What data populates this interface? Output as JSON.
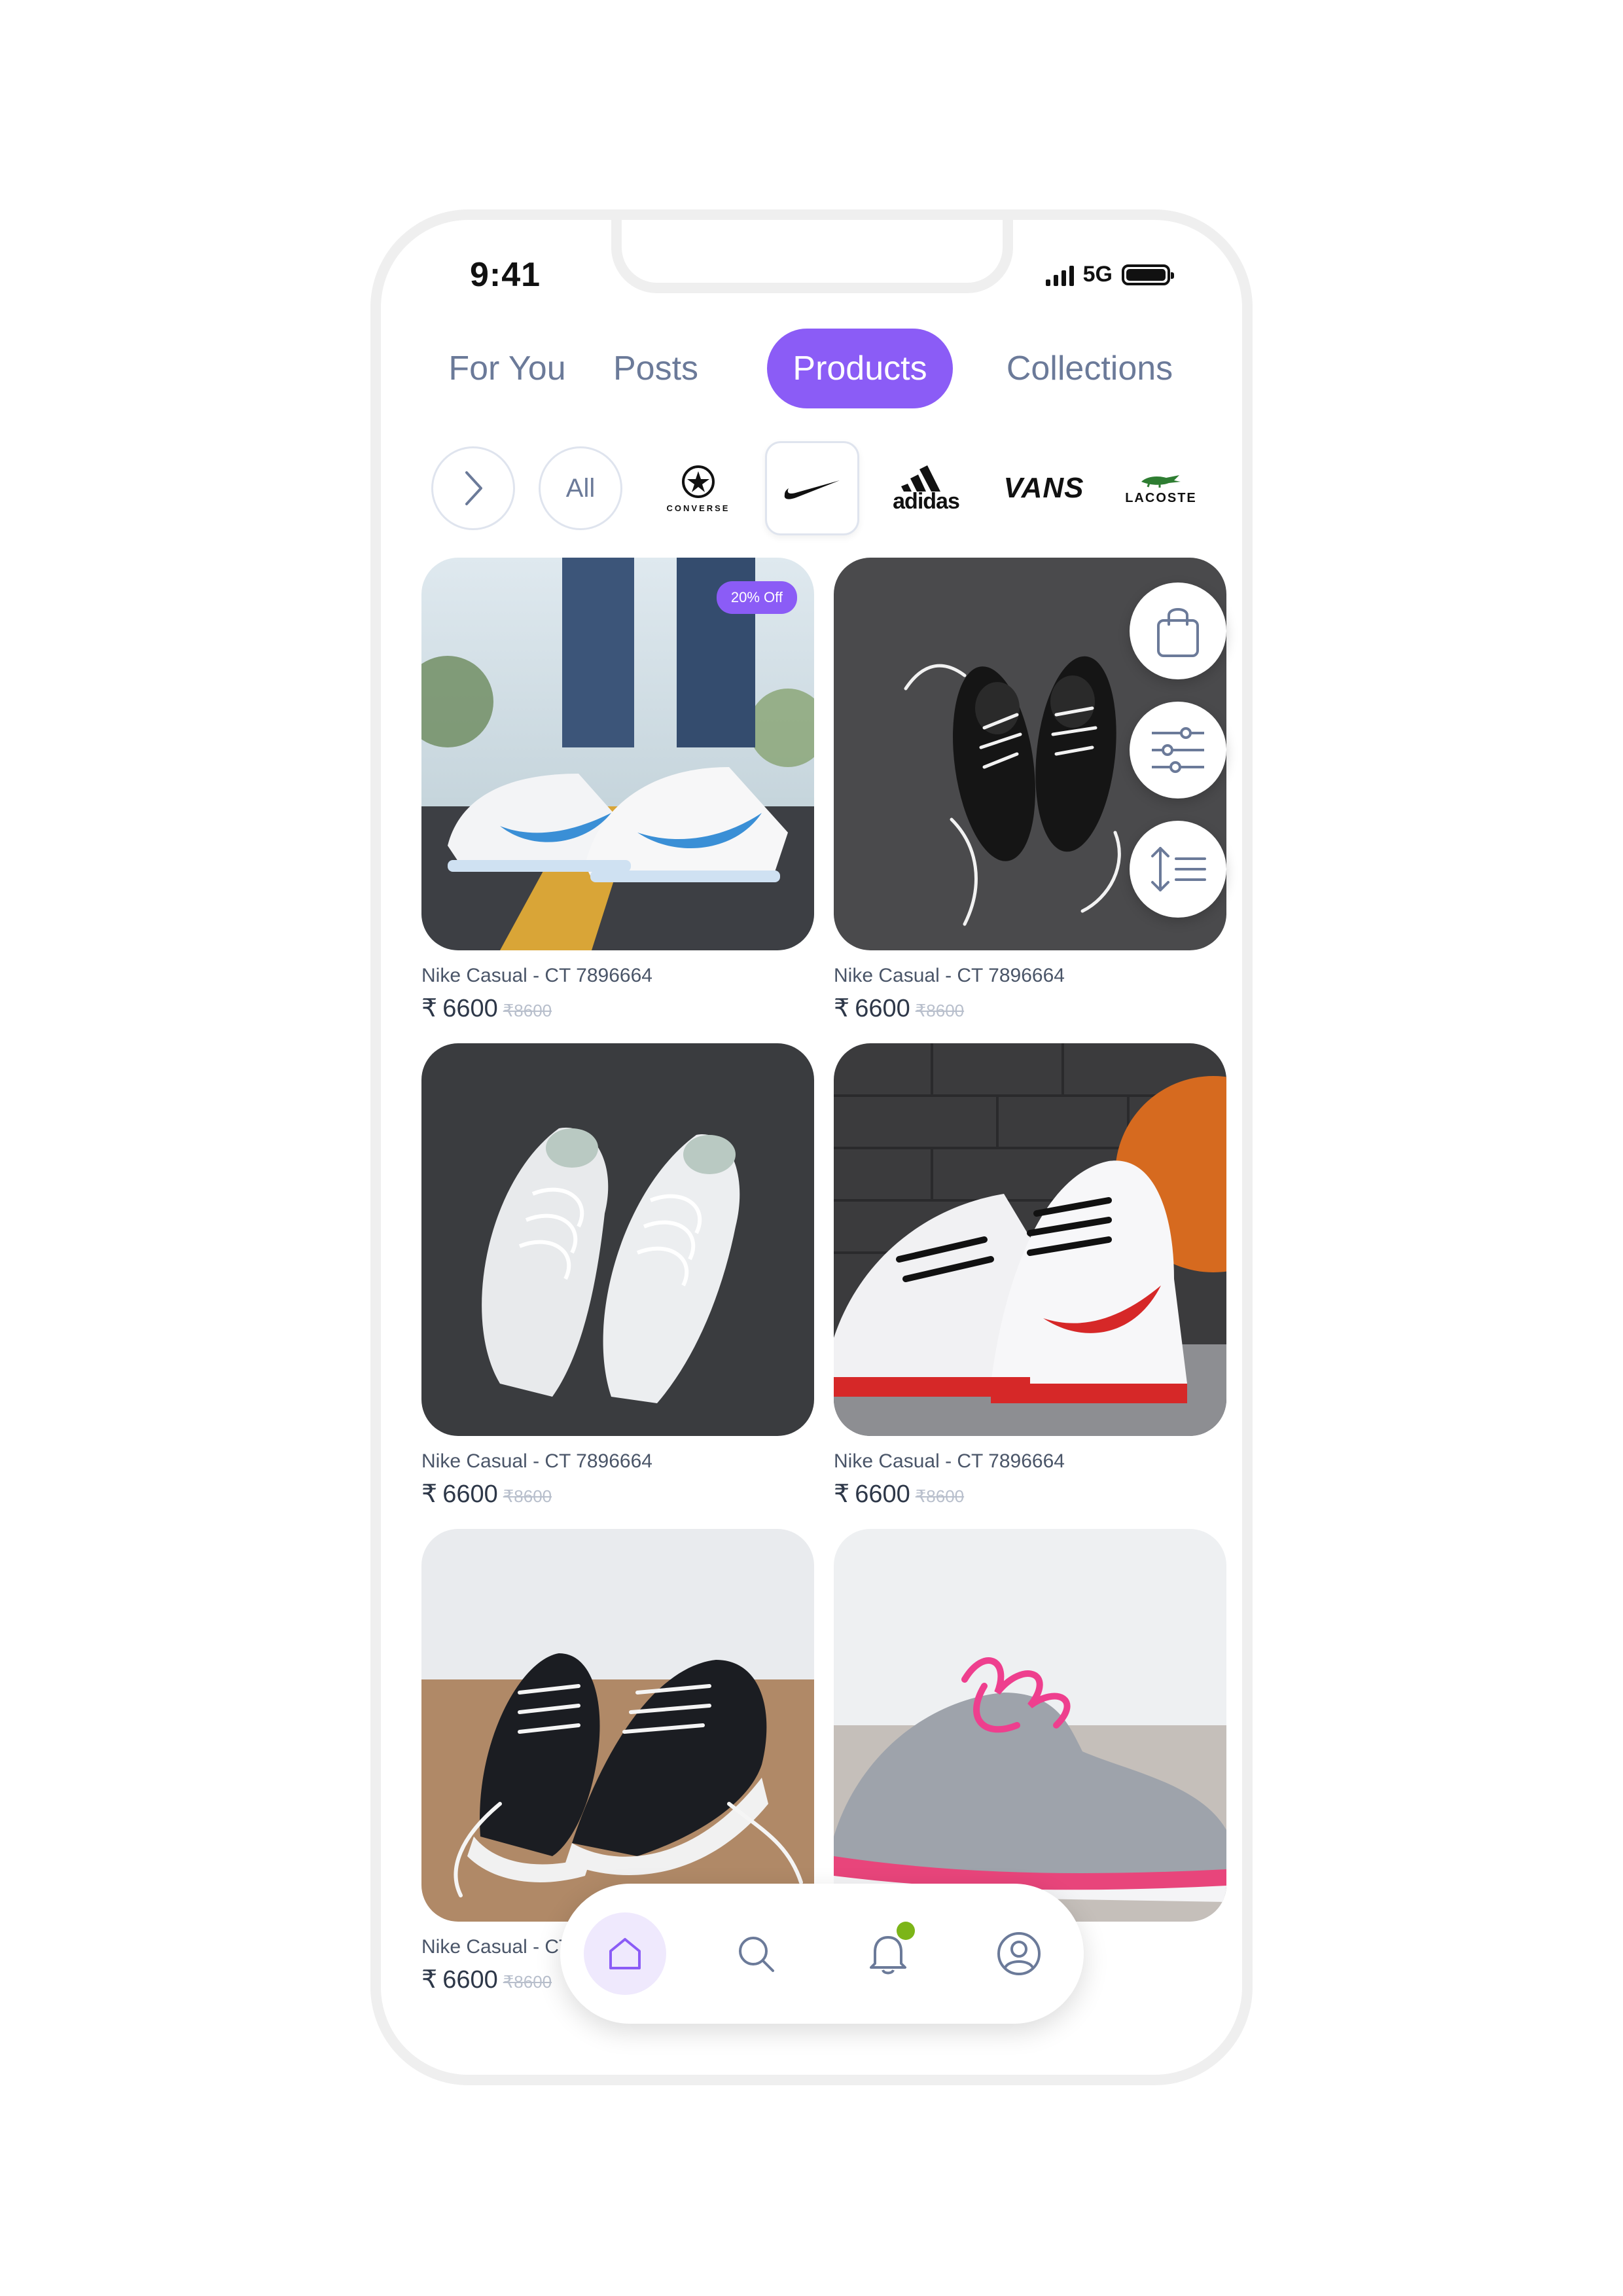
{
  "status_bar": {
    "time": "9:41",
    "network": "5G"
  },
  "tabs": [
    {
      "label": "For You",
      "active": false
    },
    {
      "label": "Posts",
      "active": false
    },
    {
      "label": "Products",
      "active": true
    },
    {
      "label": "Collections",
      "active": false
    }
  ],
  "brands": {
    "next_icon": "chevron-right-icon",
    "all_label": "All",
    "logos": [
      {
        "name": "converse",
        "text": "CONVERSE"
      },
      {
        "name": "nike",
        "selected": true
      },
      {
        "name": "adidas",
        "text": "adidas"
      },
      {
        "name": "vans",
        "text": "VANS"
      },
      {
        "name": "lacoste",
        "text": "LACOSTE"
      }
    ]
  },
  "products": [
    {
      "title": "Nike Casual - CT 7896664",
      "currency": "₹",
      "price": "6600",
      "old_price": "₹8600",
      "badge": "20% Off"
    },
    {
      "title": "Nike Casual - CT 7896664",
      "currency": "₹",
      "price": "6600",
      "old_price": "₹8600"
    },
    {
      "title": "Nike Casual - CT 7896664",
      "currency": "₹",
      "price": "6600",
      "old_price": "₹8600"
    },
    {
      "title": "Nike Casual - CT 7896664",
      "currency": "₹",
      "price": "6600",
      "old_price": "₹8600"
    },
    {
      "title": "Nike Casual - CT",
      "currency": "₹",
      "price": "6600",
      "old_price": "₹8600"
    },
    {
      "title": "",
      "currency": "",
      "price": "",
      "old_price": ""
    }
  ],
  "floating_actions": [
    "shopping-bag-icon",
    "filter-sliders-icon",
    "sort-icon"
  ],
  "bottom_nav": [
    {
      "icon": "home-icon",
      "active": true
    },
    {
      "icon": "search-icon",
      "active": false
    },
    {
      "icon": "bell-icon",
      "active": false,
      "notification": true
    },
    {
      "icon": "profile-icon",
      "active": false
    }
  ],
  "colors": {
    "accent": "#8b5cf6",
    "accent_soft": "#efe9fd",
    "notification_dot": "#7cb518",
    "muted_text": "#6b7a99"
  }
}
